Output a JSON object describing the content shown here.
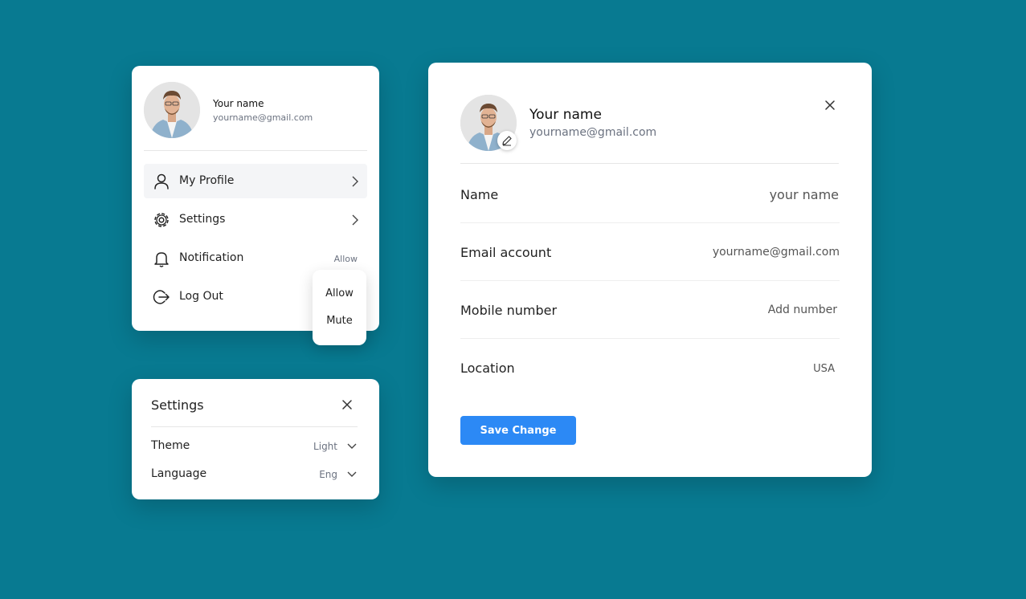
{
  "menu": {
    "user_name": "Your name",
    "user_email": "yourname@gmail.com",
    "items": [
      {
        "label": "My Profile",
        "icon": "user-icon",
        "trailing": "chevron-right-icon"
      },
      {
        "label": "Settings",
        "icon": "gear-icon",
        "trailing": "chevron-right-icon"
      },
      {
        "label": "Notification",
        "icon": "bell-icon",
        "value": "Allow"
      },
      {
        "label": "Log Out",
        "icon": "logout-icon"
      }
    ],
    "notification_dropdown": {
      "options": [
        "Allow",
        "Mute"
      ]
    }
  },
  "settings": {
    "title": "Settings",
    "rows": [
      {
        "label": "Theme",
        "value": "Light"
      },
      {
        "label": "Language",
        "value": "Eng"
      }
    ]
  },
  "profile": {
    "name": "Your name",
    "email": "yourname@gmail.com",
    "fields": [
      {
        "label": "Name",
        "value": "your name"
      },
      {
        "label": "Email account",
        "value": "yourname@gmail.com"
      },
      {
        "label": "Mobile number",
        "value": "Add number"
      },
      {
        "label": "Location",
        "value": "USA"
      }
    ],
    "save_label": "Save Change"
  },
  "colors": {
    "background": "#087a91",
    "accent": "#2c89f5",
    "card": "#ffffff"
  }
}
